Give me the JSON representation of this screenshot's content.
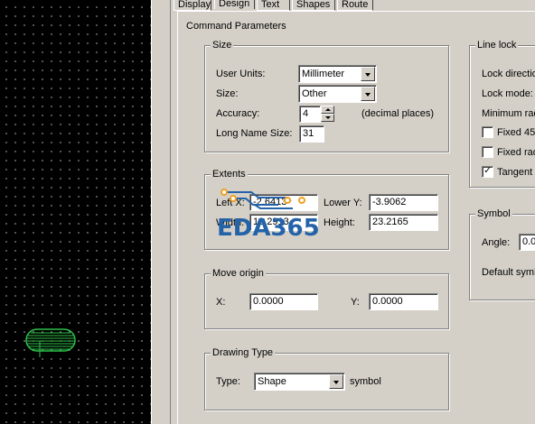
{
  "tabs": [
    {
      "label": "Display",
      "active": false
    },
    {
      "label": "Design",
      "active": true
    },
    {
      "label": "Text",
      "active": false
    },
    {
      "label": "Shapes",
      "active": false
    },
    {
      "label": "Route",
      "active": false
    }
  ],
  "command_parameters": {
    "title": "Command Parameters",
    "size": {
      "title": "Size",
      "user_units_label": "User Units:",
      "user_units_value": "Millimeter",
      "size_label": "Size:",
      "size_value": "Other",
      "accuracy_label": "Accuracy:",
      "accuracy_value": "4",
      "accuracy_suffix": "(decimal places)",
      "long_name_label": "Long Name Size:",
      "long_name_value": "31"
    },
    "extents": {
      "title": "Extents",
      "left_x_label": "Left X:",
      "left_x_value": "-2.6413",
      "lower_y_label": "Lower Y:",
      "lower_y_value": "-3.9062",
      "width_label": "Width:",
      "width_value": "10.2913",
      "height_label": "Height:",
      "height_value": "23.2165"
    },
    "move_origin": {
      "title": "Move origin",
      "x_label": "X:",
      "x_value": "0.0000",
      "y_label": "Y:",
      "y_value": "0.0000"
    },
    "drawing_type": {
      "title": "Drawing Type",
      "type_label": "Type:",
      "type_value": "Shape",
      "type_suffix": "symbol"
    }
  },
  "line_lock": {
    "title": "Line lock",
    "lock_direction_label": "Lock directio",
    "lock_mode_label": "Lock mode:",
    "minimum_radius_label": "Minimum rad",
    "fixed_45_label": "Fixed 45",
    "fixed_45_checked": false,
    "fixed_radius_label": "Fixed rad",
    "fixed_radius_checked": false,
    "tangent_label": "Tangent",
    "tangent_checked": true
  },
  "symbol": {
    "title": "Symbol",
    "angle_label": "Angle:",
    "angle_value": "0.0",
    "default_symbol_label": "Default symb"
  },
  "watermark": {
    "text": "EDA365"
  },
  "colors": {
    "canvas_background": "#000000",
    "dialog_face": "#d4d0c8",
    "pad_green": "#2ec24a",
    "watermark_blue": "#2463a8",
    "watermark_orange": "#f0a020"
  }
}
